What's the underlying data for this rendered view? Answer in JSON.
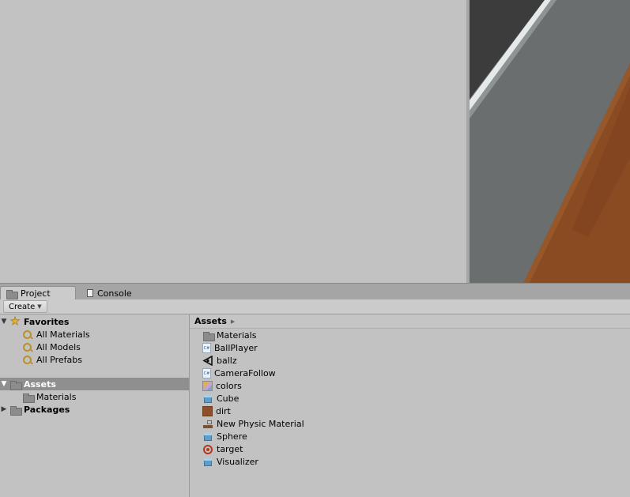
{
  "tabs": {
    "project": "Project",
    "console": "Console"
  },
  "toolbar": {
    "create_label": "Create"
  },
  "tree": {
    "favorites": "Favorites",
    "favorite_items": [
      "All Materials",
      "All Models",
      "All Prefabs"
    ],
    "assets": "Assets",
    "assets_children": [
      "Materials"
    ],
    "packages": "Packages"
  },
  "breadcrumb": {
    "root": "Assets"
  },
  "assets": [
    {
      "name": "Materials",
      "icon": "folder-icon"
    },
    {
      "name": "BallPlayer",
      "icon": "csharp-script-icon"
    },
    {
      "name": "ballz",
      "icon": "unity-scene-icon"
    },
    {
      "name": "CameraFollow",
      "icon": "csharp-script-icon"
    },
    {
      "name": "colors",
      "icon": "texture-icon"
    },
    {
      "name": "Cube",
      "icon": "prefab-icon"
    },
    {
      "name": "dirt",
      "icon": "material-icon"
    },
    {
      "name": "New Physic Material",
      "icon": "physic-material-icon"
    },
    {
      "name": "Sphere",
      "icon": "prefab-icon"
    },
    {
      "name": "target",
      "icon": "target-icon"
    },
    {
      "name": "Visualizer",
      "icon": "prefab-icon"
    }
  ],
  "colors": {
    "panel_bg": "#c2c2c2",
    "selection_bg": "#8f8f8f",
    "scene_dark": "#3c3c3c",
    "scene_gray": "#6b6e6f",
    "scene_dirt": "#8b4b22"
  }
}
